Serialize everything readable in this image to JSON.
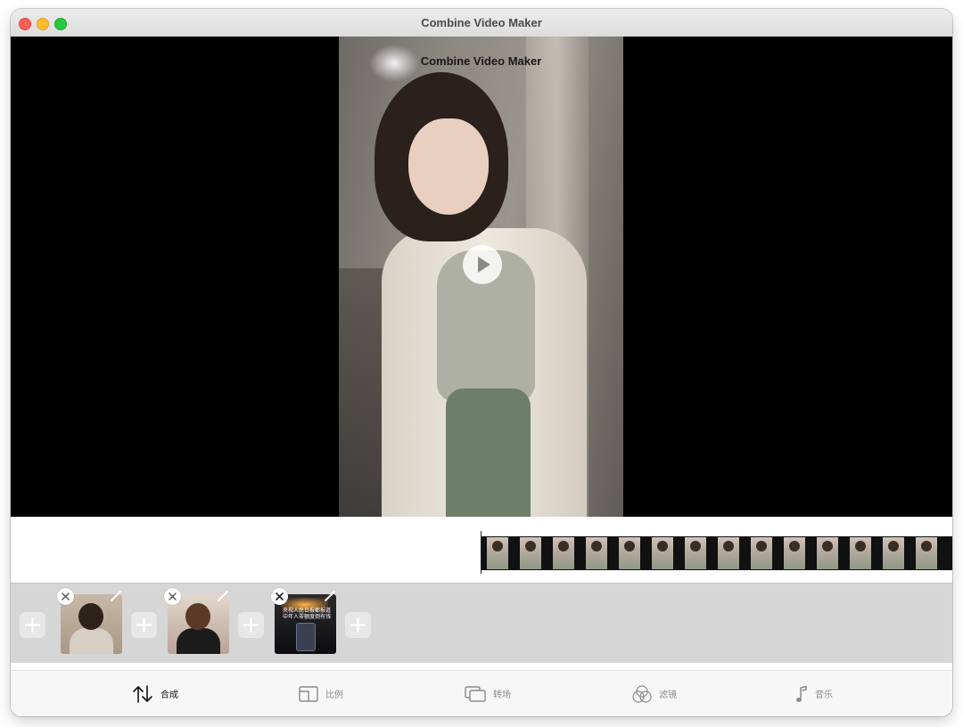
{
  "window": {
    "title": "Combine Video Maker"
  },
  "player": {
    "overlay_title": "Combine Video Maker"
  },
  "clips": [
    {
      "id": 1
    },
    {
      "id": 2
    },
    {
      "id": 3,
      "caption": "央视人民日报都报道中年人零额度倒有钱"
    }
  ],
  "tabs": [
    {
      "key": "combine",
      "label": "合成",
      "icon": "swap-vertical-arrows-icon",
      "active": true
    },
    {
      "key": "ratio",
      "label": "比例",
      "icon": "aspect-ratio-icon",
      "active": false
    },
    {
      "key": "transition",
      "label": "转场",
      "icon": "transition-icon",
      "active": false
    },
    {
      "key": "filter",
      "label": "滤镜",
      "icon": "filter-icon",
      "active": false
    },
    {
      "key": "music",
      "label": "音乐",
      "icon": "music-note-icon",
      "active": false
    }
  ],
  "colors": {
    "accent_close": "#fe5f57",
    "accent_min": "#febc2e",
    "accent_max": "#28c840",
    "clip_bar": "#d6d6d6"
  }
}
